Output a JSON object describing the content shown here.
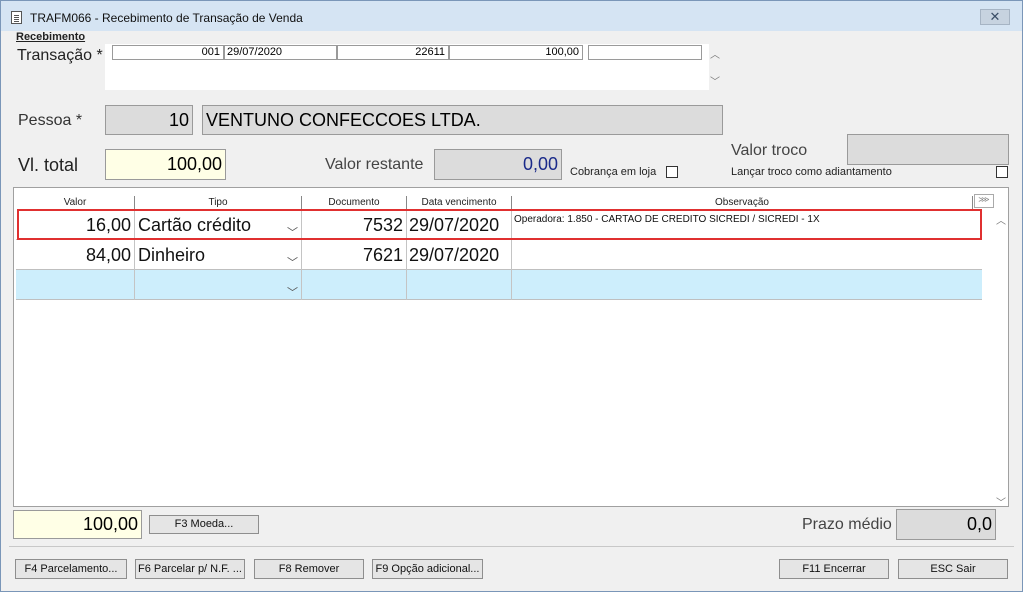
{
  "window": {
    "title": "TRAFM066 - Recebimento de Transação de Venda",
    "close_symbol": "✕"
  },
  "section": {
    "label": "Recebimento"
  },
  "transacao": {
    "label": "Transação *",
    "code": "001",
    "date": "29/07/2020",
    "number": "22611",
    "value": "100,00",
    "extra": ""
  },
  "pessoa": {
    "label": "Pessoa *",
    "id": "10",
    "name": "VENTUNO CONFECCOES LTDA."
  },
  "vl_total": {
    "label": "Vl. total",
    "value": "100,00"
  },
  "valor_restante": {
    "label": "Valor restante",
    "value": "0,00"
  },
  "cobranca_loja": {
    "label": "Cobrança em loja"
  },
  "valor_troco": {
    "label": "Valor troco",
    "value": ""
  },
  "lancar_troco": {
    "label": "Lançar troco como adiantamento"
  },
  "grid": {
    "headers": [
      "Valor",
      "Tipo",
      "Documento",
      "Data vencimento",
      "Observação"
    ],
    "rows": [
      {
        "valor": "16,00",
        "tipo": "Cartão crédito",
        "documento": "7532",
        "data": "29/07/2020",
        "obs": "Operadora: 1.850 - CARTAO DE CREDITO SICREDI / SICREDI - 1X"
      },
      {
        "valor": "84,00",
        "tipo": "Dinheiro",
        "documento": "7621",
        "data": "29/07/2020",
        "obs": ""
      }
    ]
  },
  "footer": {
    "total": "100,00",
    "moeda_btn": "F3 Moeda...",
    "prazo_label": "Prazo médio",
    "prazo_value": "0,0"
  },
  "buttons": {
    "parcelamento": "F4 Parcelamento...",
    "parcelar_nf": "F6 Parcelar p/ N.F. ...",
    "remover": "F8 Remover",
    "opcao": "F9 Opção adicional...",
    "encerrar": "F11 Encerrar",
    "sair": "ESC Sair"
  },
  "colors": {
    "highlight_border": "#e03030",
    "new_row": "#cdeefc",
    "accent_blue": "#1a2a8a"
  }
}
